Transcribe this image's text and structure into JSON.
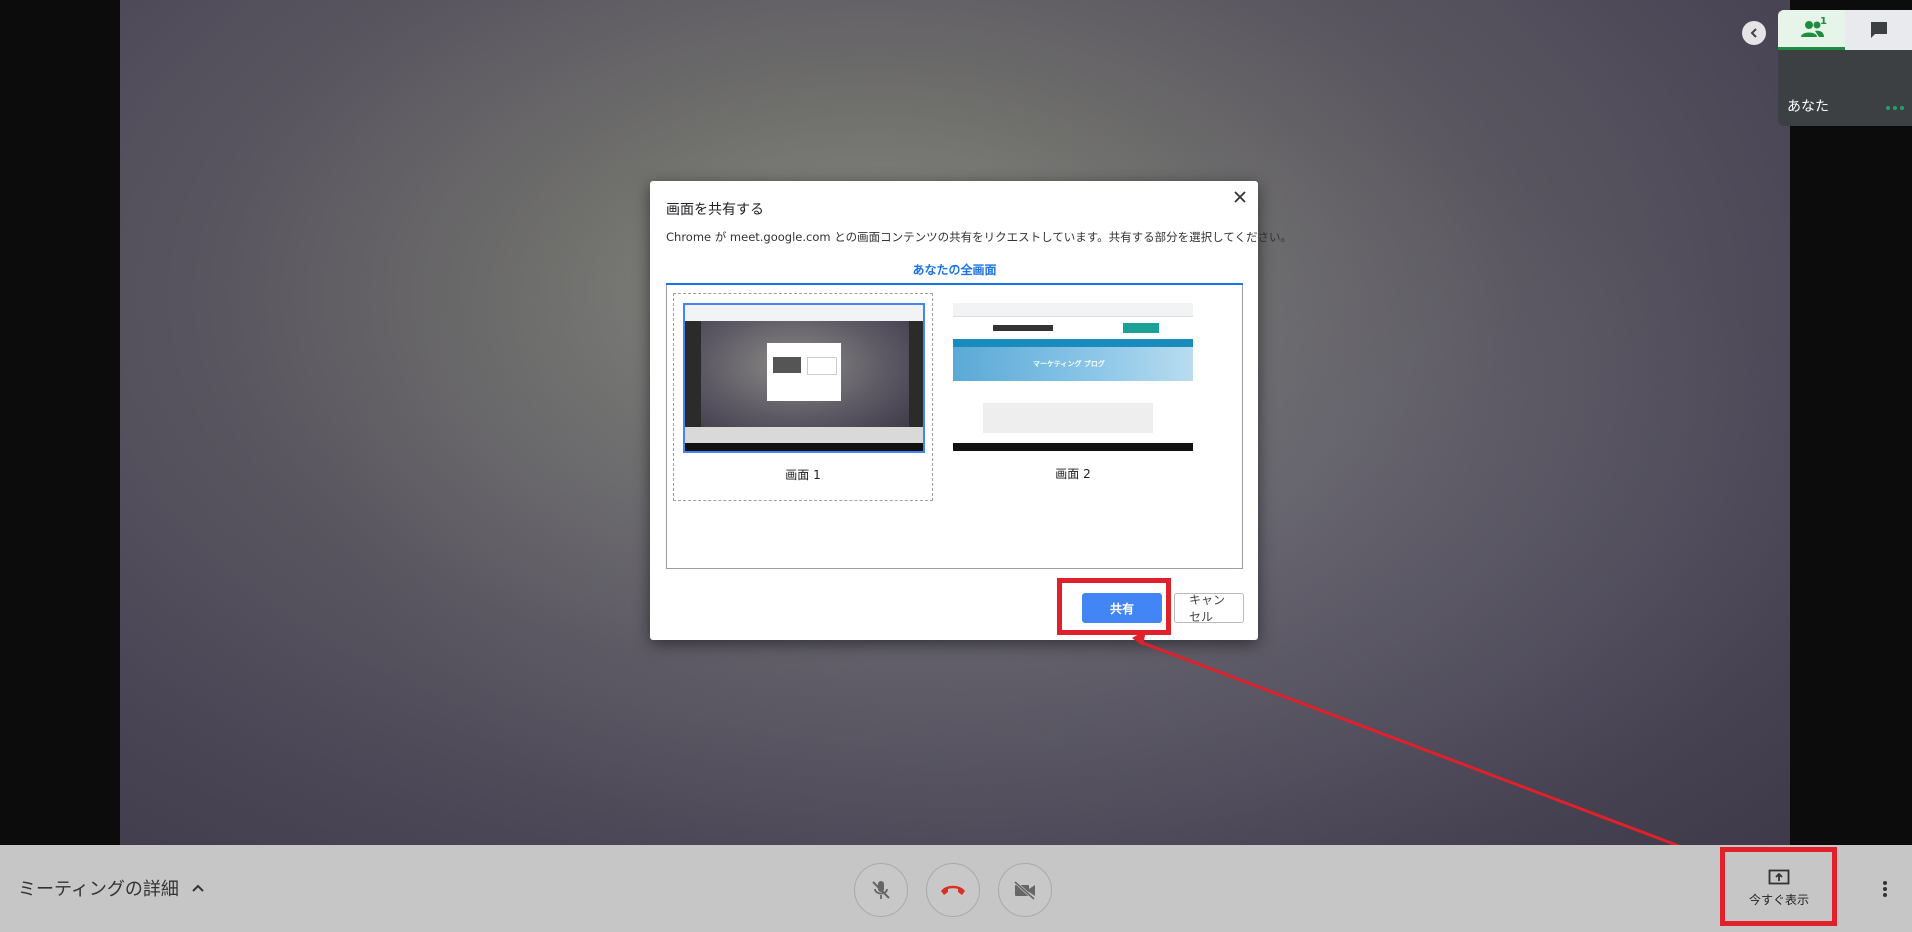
{
  "participants": {
    "count": "1",
    "you_label": "あなた"
  },
  "dialog": {
    "title": "画面を共有する",
    "description": "Chrome が meet.google.com との画面コンテンツの共有をリクエストしています。共有する部分を選択してください。",
    "tab_label": "あなたの全画面",
    "screens": [
      {
        "label": "画面 1",
        "selected": true
      },
      {
        "label": "画面 2",
        "selected": false
      }
    ],
    "thumbnail2_banner": "マーケティング ブログ",
    "share_button": "共有",
    "cancel_button": "キャンセル"
  },
  "bottombar": {
    "meeting_details": "ミーティングの詳細",
    "present_now": "今すぐ表示"
  },
  "colors": {
    "highlight": "#e0202a",
    "primary": "#4285f4",
    "hangup": "#d93025"
  }
}
